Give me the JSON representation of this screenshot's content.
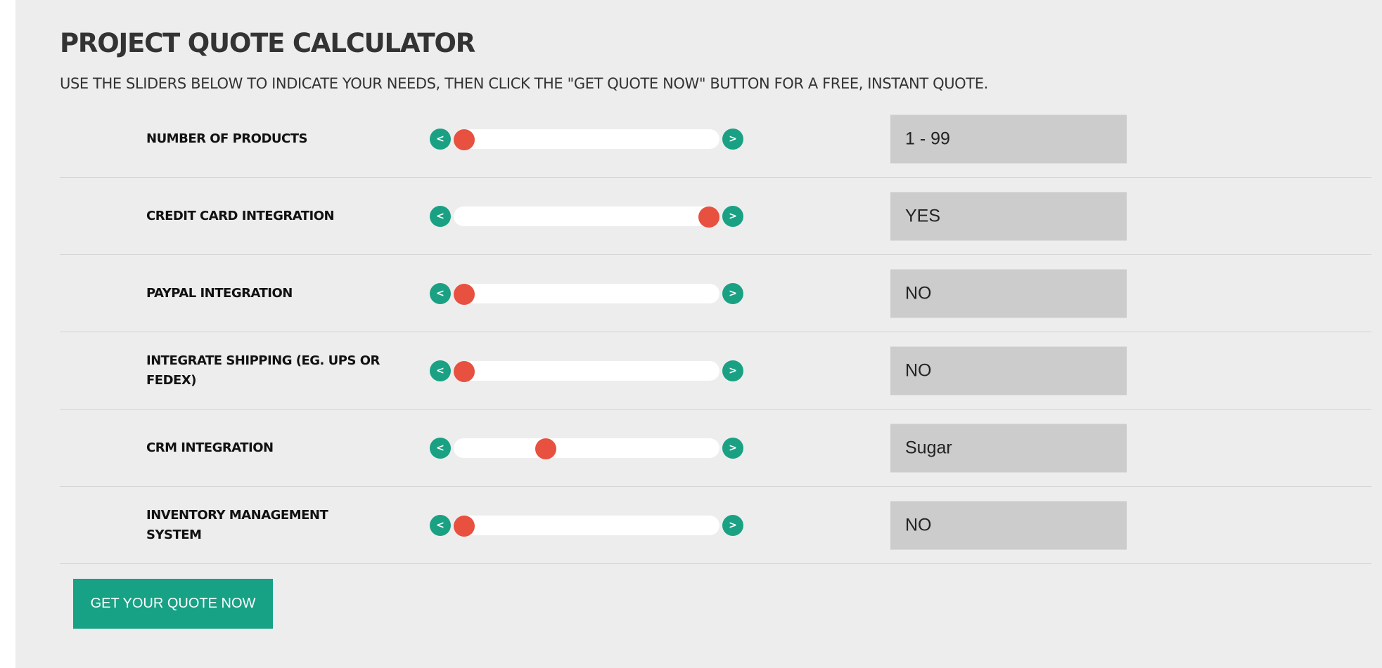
{
  "header": {
    "title": "PROJECT QUOTE CALCULATOR",
    "instructions": "USE THE SLIDERS BELOW TO INDICATE YOUR NEEDS, THEN CLICK THE \"GET QUOTE NOW\" BUTTON FOR A FREE, INSTANT QUOTE."
  },
  "arrows": {
    "prev": "<",
    "next": ">"
  },
  "colors": {
    "arrow": "#1aa183",
    "thumb": "#e8503f",
    "button": "#17a185",
    "panel_background": "#ededed",
    "value_box": "#cccccc"
  },
  "sliders": [
    {
      "label": "NUMBER OF PRODUCTS",
      "value": "1 - 99",
      "position": 0.0
    },
    {
      "label": "CREDIT CARD INTEGRATION",
      "value": "YES",
      "position": 1.0
    },
    {
      "label": "PAYPAL INTEGRATION",
      "value": "NO",
      "position": 0.0
    },
    {
      "label": "INTEGRATE SHIPPING (EG. UPS OR FEDEX)",
      "value": "NO",
      "position": 0.0
    },
    {
      "label": "CRM INTEGRATION",
      "value": "Sugar",
      "position": 0.333
    },
    {
      "label": "INVENTORY MANAGEMENT SYSTEM",
      "value": "NO",
      "position": 0.0
    }
  ],
  "actions": {
    "get_quote_label": "GET YOUR QUOTE NOW"
  }
}
